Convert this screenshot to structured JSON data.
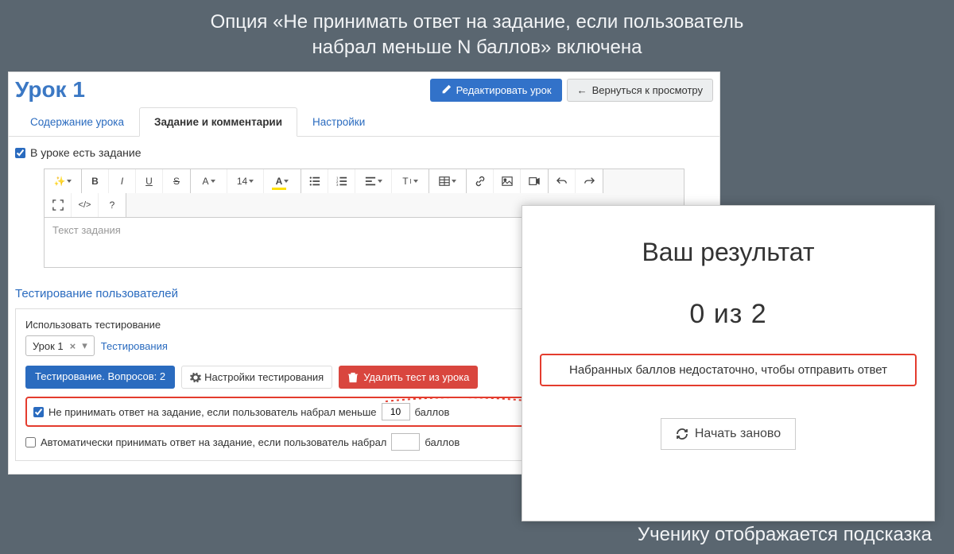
{
  "annotations": {
    "top": "Опция «Не принимать ответ на задание, если пользователь\nнабрал меньше N баллов» включена",
    "bottom": "Ученику отображается подсказка"
  },
  "lesson": {
    "title": "Урок 1"
  },
  "header_buttons": {
    "edit": "Редактировать урок",
    "back": "Вернуться к просмотру"
  },
  "tabs": {
    "content": "Содержание урока",
    "task": "Задание и комментарии",
    "settings": "Настройки"
  },
  "has_task_label": "В уроке есть задание",
  "editor": {
    "placeholder": "Текст задания"
  },
  "testing": {
    "section_title": "Тестирование пользователей",
    "use_label": "Использовать тестирование",
    "selected_test": "Урок 1",
    "tests_link": "Тестирования",
    "info_button": "Тестирование. Вопросов: 2",
    "settings_button": "Настройки тестирования",
    "delete_button": "Удалить тест из урока",
    "reject": {
      "prefix": "Не принимать ответ на задание, если пользователь набрал меньше",
      "value": "10",
      "suffix": "баллов"
    },
    "accept": {
      "prefix": "Автоматически принимать ответ на задание, если пользователь набрал",
      "value": "",
      "suffix": "баллов"
    }
  },
  "result": {
    "title": "Ваш результат",
    "score": "0 из 2",
    "warning": "Набранных баллов недостаточно, чтобы отправить ответ",
    "restart": "Начать заново"
  }
}
